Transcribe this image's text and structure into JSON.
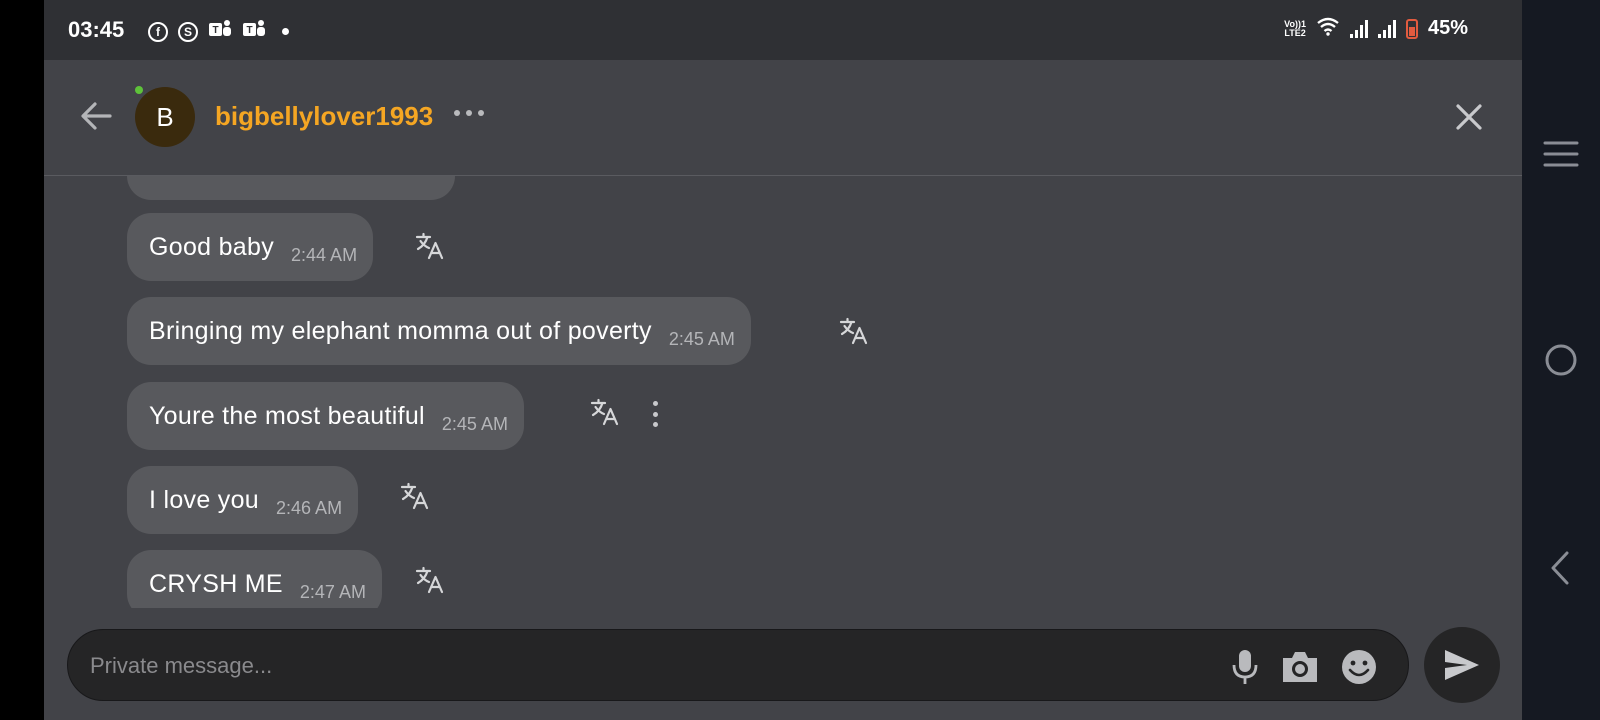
{
  "status_bar": {
    "time": "03:45",
    "app_icons": [
      "facebook-icon",
      "skype-icon",
      "teams-icon",
      "teams-icon"
    ],
    "network_label": "VoLTE",
    "battery_pct": "45%"
  },
  "header": {
    "avatar_letter": "B",
    "username": "bigbellylover1993",
    "username_color": "#f5a623",
    "online": true
  },
  "messages": [
    {
      "text": "Good baby",
      "time": "2:44 AM"
    },
    {
      "text": "Bringing my elephant momma out of poverty",
      "time": "2:45 AM"
    },
    {
      "text": "Youre the most beautiful",
      "time": "2:45 AM"
    },
    {
      "text": "I love you",
      "time": "2:46 AM"
    },
    {
      "text": "CRYSH ME",
      "time": "2:47 AM"
    }
  ],
  "composer": {
    "placeholder": "Private message..."
  }
}
